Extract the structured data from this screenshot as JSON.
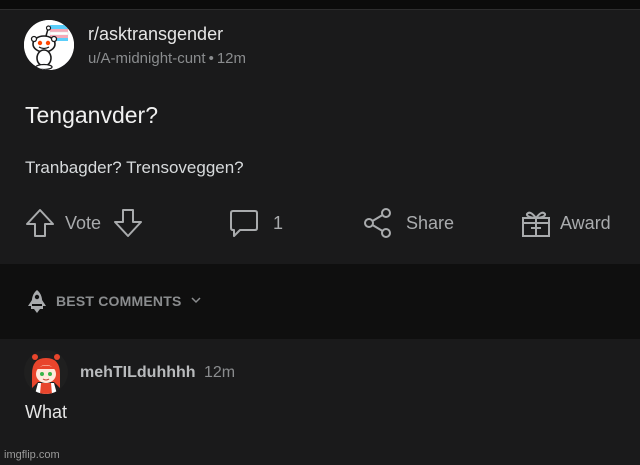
{
  "post": {
    "subreddit": "r/asktransgender",
    "author": "u/A-midnight-cunt",
    "separator": "•",
    "age": "12m",
    "title": "Tenganvder?",
    "body": "Tranbagder? Trensoveggen?"
  },
  "actions": {
    "vote_label": "Vote",
    "comments_count": "1",
    "share_label": "Share",
    "award_label": "Award"
  },
  "comments_header": {
    "sort_label": "BEST COMMENTS"
  },
  "comments": [
    {
      "author": "mehTILduhhhh",
      "age": "12m",
      "text": "What"
    }
  ],
  "watermark": "imgflip.com",
  "colors": {
    "background": "#1a1a1b",
    "band": "#0f0f0f",
    "text": "#d7dadc",
    "muted": "#8a8c8e",
    "trans_blue": "#5bcefa",
    "trans_pink": "#f5a9b8",
    "avatar_hair": "#e8452c"
  },
  "icons": [
    "snoo-avatar-icon",
    "upvote-icon",
    "downvote-icon",
    "comment-icon",
    "share-icon",
    "award-icon",
    "rocket-icon",
    "chevron-down-icon"
  ]
}
